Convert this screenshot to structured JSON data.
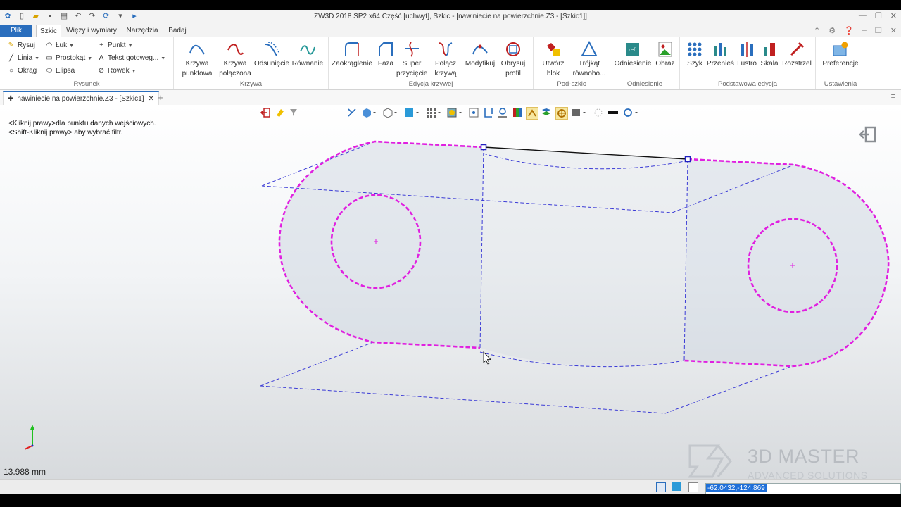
{
  "window": {
    "title": "ZW3D 2018 SP2 x64        Część [uchwyt],  Szkic - [nawiniecie na powierzchnie.Z3 - [Szkic1]]"
  },
  "menu": {
    "file": "Plik",
    "tabs": [
      "Szkic",
      "Więzy i wymiary",
      "Narzędzia",
      "Badaj"
    ]
  },
  "ribbon": {
    "rysunek": {
      "label": "Rysunek",
      "items": [
        "Rysuj",
        "Łuk",
        "Punkt",
        "Linia",
        "Prostokąt",
        "Tekst gotoweg...",
        "Okrąg",
        "Elipsa",
        "Rowek"
      ]
    },
    "krzywa": {
      "label": "Krzywa",
      "buttons": [
        {
          "l1": "Krzywa",
          "l2": "punktowa"
        },
        {
          "l1": "Krzywa",
          "l2": "połączona"
        },
        {
          "l1": "Odsunięcie",
          "l2": ""
        },
        {
          "l1": "Równanie",
          "l2": ""
        }
      ]
    },
    "edycja": {
      "label": "Edycja krzywej",
      "buttons": [
        {
          "l1": "Zaokrąglenie",
          "l2": ""
        },
        {
          "l1": "Faza",
          "l2": ""
        },
        {
          "l1": "Super",
          "l2": "przycięcie"
        },
        {
          "l1": "Połącz",
          "l2": "krzywą"
        },
        {
          "l1": "Modyfikuj",
          "l2": ""
        },
        {
          "l1": "Obrysuj",
          "l2": "profil"
        }
      ]
    },
    "podszkic": {
      "label": "Pod-szkic",
      "buttons": [
        {
          "l1": "Utwórz",
          "l2": "blok"
        },
        {
          "l1": "Trójkąt",
          "l2": "równobo..."
        }
      ]
    },
    "odniesienie": {
      "label": "Odniesienie",
      "buttons": [
        {
          "l1": "Odniesienie",
          "l2": ""
        },
        {
          "l1": "Obraz",
          "l2": ""
        }
      ]
    },
    "podstawowa": {
      "label": "Podstawowa edycja",
      "buttons": [
        {
          "l1": "Szyk",
          "l2": ""
        },
        {
          "l1": "Przenieś",
          "l2": ""
        },
        {
          "l1": "Lustro",
          "l2": ""
        },
        {
          "l1": "Skala",
          "l2": ""
        },
        {
          "l1": "Rozstrzel",
          "l2": ""
        }
      ]
    },
    "ustawienia": {
      "label": "Ustawienia",
      "buttons": [
        {
          "l1": "Preferencje",
          "l2": ""
        }
      ]
    }
  },
  "document_tab": "nawiniecie na powierzchnie.Z3 - [Szkic1]",
  "viewport": {
    "prompt_line1": "<Kliknij prawy>dla punktu danych wejściowych.",
    "prompt_line2": "<Shift-Kliknij prawy> aby wybrać filtr.",
    "scale": "13.988 mm"
  },
  "watermark": {
    "line1": "3D MASTER",
    "line2": "ADVANCED SOLUTIONS"
  },
  "status": {
    "coordinates": "-62.0432,-124.869"
  },
  "colors": {
    "accent": "#2a6ebd",
    "sketch": "#e020e0",
    "dashed": "#3b3bd6"
  }
}
